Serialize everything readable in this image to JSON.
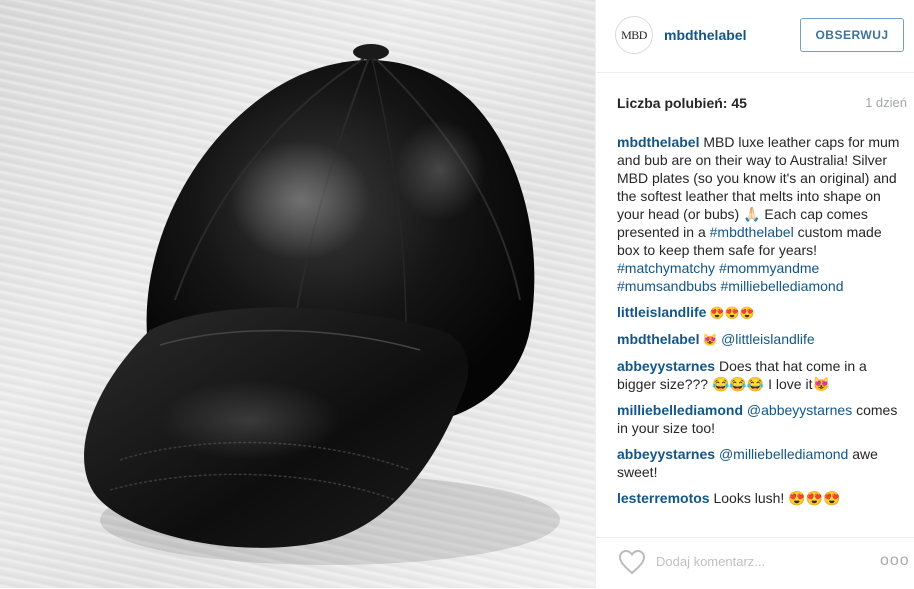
{
  "post": {
    "image_alt": "Black leather baseball cap on a light wood surface",
    "avatar_text": "MBD",
    "username": "mbdthelabel",
    "follow_label": "OBSERWUJ",
    "likes": "Liczba polubień: 45",
    "time_ago": "1 dzień"
  },
  "caption": {
    "user": "mbdthelabel",
    "text_1": " MBD luxe leather caps for mum and bub are on their way to Australia! Silver MBD plates (so you know it's an original) and the softest leather that melts into shape on your head (or bubs) 🙏🏻 Each cap comes presented in a ",
    "tag_1": "#mbdthelabel",
    "text_2": " custom made box to keep them safe for years! ",
    "tag_2": "#matchymatchy",
    "tag_3": "#mommyandme",
    "tag_4": "#mumsandbubs",
    "tag_5": "#milliebellediamond"
  },
  "comments": [
    {
      "user": "littleislandlife",
      "text": " 😍😍😍"
    },
    {
      "user": "mbdthelabel",
      "text": " 😻 ",
      "mention": "@littleislandlife"
    },
    {
      "user": "abbeyystarnes",
      "text": " Does that hat come in a bigger size??? 😂😂😂 I love it😻"
    },
    {
      "user": "milliebellediamond",
      "text": " ",
      "mention": "@abbeyystarnes",
      "text_after": " comes in your size too!"
    },
    {
      "user": "abbeyystarnes",
      "text": " ",
      "mention": "@milliebellediamond",
      "text_after": " awe sweet!"
    },
    {
      "user": "lesterremotos",
      "text": " Looks lush! 😍😍😍"
    }
  ],
  "footer": {
    "placeholder": "Dodaj komentarz...",
    "more_label": "ooo",
    "like_icon": "heart-outline-icon"
  },
  "colors": {
    "link": "#125688",
    "follow_border": "#70a0c8",
    "muted": "#a5a7aa"
  }
}
